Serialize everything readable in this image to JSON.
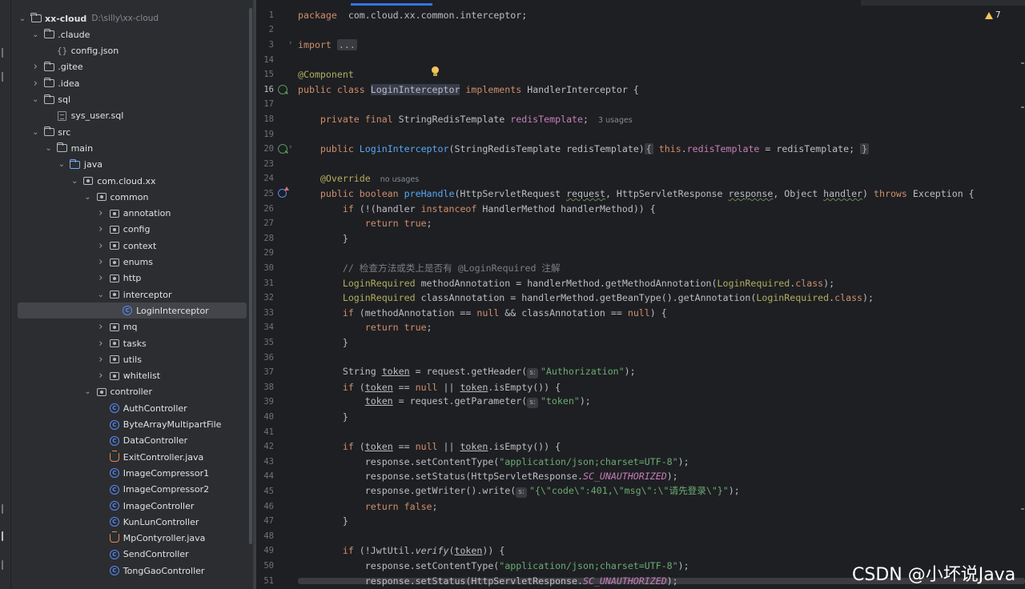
{
  "project": {
    "rows": [
      {
        "label": "xx-cloud",
        "path": "D:\\silly\\xx-cloud",
        "level": 0,
        "arrow": "down",
        "icon": "folder"
      },
      {
        "label": ".claude",
        "level": 1,
        "arrow": "down",
        "icon": "folder"
      },
      {
        "label": "config.json",
        "level": 2,
        "arrow": "",
        "icon": "json"
      },
      {
        "label": ".gitee",
        "level": 1,
        "arrow": "right",
        "icon": "folder"
      },
      {
        "label": ".idea",
        "level": 1,
        "arrow": "right",
        "icon": "folder"
      },
      {
        "label": "sql",
        "level": 1,
        "arrow": "down",
        "icon": "folder"
      },
      {
        "label": "sys_user.sql",
        "level": 2,
        "arrow": "",
        "icon": "sql"
      },
      {
        "label": "src",
        "level": 1,
        "arrow": "down",
        "icon": "folder"
      },
      {
        "label": "main",
        "level": 2,
        "arrow": "down",
        "icon": "folder"
      },
      {
        "label": "java",
        "level": 3,
        "arrow": "down",
        "icon": "folder-blue"
      },
      {
        "label": "com.cloud.xx",
        "level": 4,
        "arrow": "down",
        "icon": "package"
      },
      {
        "label": "common",
        "level": 5,
        "arrow": "down",
        "icon": "package"
      },
      {
        "label": "annotation",
        "level": 6,
        "arrow": "right",
        "icon": "package"
      },
      {
        "label": "config",
        "level": 6,
        "arrow": "right",
        "icon": "package"
      },
      {
        "label": "context",
        "level": 6,
        "arrow": "right",
        "icon": "package"
      },
      {
        "label": "enums",
        "level": 6,
        "arrow": "right",
        "icon": "package"
      },
      {
        "label": "http",
        "level": 6,
        "arrow": "right",
        "icon": "package"
      },
      {
        "label": "interceptor",
        "level": 6,
        "arrow": "down",
        "icon": "package"
      },
      {
        "label": "LoginInterceptor",
        "level": 7,
        "arrow": "",
        "icon": "class",
        "selected": true
      },
      {
        "label": "mq",
        "level": 6,
        "arrow": "right",
        "icon": "package"
      },
      {
        "label": "tasks",
        "level": 6,
        "arrow": "right",
        "icon": "package"
      },
      {
        "label": "utils",
        "level": 6,
        "arrow": "right",
        "icon": "package"
      },
      {
        "label": "whitelist",
        "level": 6,
        "arrow": "right",
        "icon": "package"
      },
      {
        "label": "controller",
        "level": 5,
        "arrow": "down",
        "icon": "package"
      },
      {
        "label": "AuthController",
        "level": 6,
        "arrow": "",
        "icon": "class"
      },
      {
        "label": "ByteArrayMultipartFile",
        "level": 6,
        "arrow": "",
        "icon": "class"
      },
      {
        "label": "DataController",
        "level": 6,
        "arrow": "",
        "icon": "class"
      },
      {
        "label": "ExitController.java",
        "level": 6,
        "arrow": "",
        "icon": "java"
      },
      {
        "label": "ImageCompressor1",
        "level": 6,
        "arrow": "",
        "icon": "class"
      },
      {
        "label": "ImageCompressor2",
        "level": 6,
        "arrow": "",
        "icon": "class"
      },
      {
        "label": "ImageController",
        "level": 6,
        "arrow": "",
        "icon": "class"
      },
      {
        "label": "KunLunController",
        "level": 6,
        "arrow": "",
        "icon": "class"
      },
      {
        "label": "MpContyroller.java",
        "level": 6,
        "arrow": "",
        "icon": "java"
      },
      {
        "label": "SendController",
        "level": 6,
        "arrow": "",
        "icon": "class"
      },
      {
        "label": "TongGaoController",
        "level": 6,
        "arrow": "",
        "icon": "class"
      }
    ]
  },
  "editor": {
    "warnings_count": "7",
    "current_line": "16",
    "lines": [
      {
        "n": "1",
        "segs": [
          [
            "kw",
            "package"
          ],
          [
            "",
            "  com.cloud.xx.common.interceptor;"
          ]
        ]
      },
      {
        "n": "2",
        "segs": []
      },
      {
        "n": "3",
        "gutter": "fold",
        "segs": [
          [
            "kw",
            "import"
          ],
          [
            "",
            " "
          ],
          [
            "fold",
            "..."
          ]
        ]
      },
      {
        "n": "14",
        "segs": []
      },
      {
        "n": "15",
        "segs": [
          [
            "ann",
            "@Component"
          ]
        ]
      },
      {
        "n": "16",
        "gutter": "bean",
        "segs": [
          [
            "kw",
            "public class "
          ],
          [
            "sel",
            "LoginInterceptor"
          ],
          [
            "",
            " "
          ],
          [
            "kw",
            "implements"
          ],
          [
            "",
            " HandlerInterceptor {"
          ]
        ]
      },
      {
        "n": "17",
        "segs": []
      },
      {
        "n": "18",
        "segs": [
          [
            "",
            "    "
          ],
          [
            "kw",
            "private final"
          ],
          [
            "",
            " StringRedisTemplate "
          ],
          [
            "fld",
            "redisTemplate"
          ],
          [
            "",
            ";"
          ],
          [
            "hint",
            "3 usages"
          ]
        ]
      },
      {
        "n": "19",
        "segs": []
      },
      {
        "n": "20",
        "gutter": "bean-fold",
        "segs": [
          [
            "",
            "    "
          ],
          [
            "kw",
            "public "
          ],
          [
            "fn",
            "LoginInterceptor"
          ],
          [
            "",
            "(StringRedisTemplate redisTemplate)"
          ],
          [
            "fold",
            "{"
          ],
          [
            "",
            " "
          ],
          [
            "kw",
            "this"
          ],
          [
            "",
            "."
          ],
          [
            "fld",
            "redisTemplate"
          ],
          [
            "",
            " = redisTemplate; "
          ],
          [
            "fold",
            "}"
          ]
        ]
      },
      {
        "n": "23",
        "segs": []
      },
      {
        "n": "24",
        "segs": [
          [
            "",
            "    "
          ],
          [
            "ann",
            "@Override"
          ],
          [
            "hint",
            "no usages"
          ]
        ]
      },
      {
        "n": "25",
        "gutter": "impl",
        "segs": [
          [
            "",
            "    "
          ],
          [
            "kw",
            "public boolean "
          ],
          [
            "fn",
            "preHandle"
          ],
          [
            "",
            "(HttpServletRequest "
          ],
          [
            "wavy",
            "request"
          ],
          [
            "",
            ", HttpServletResponse "
          ],
          [
            "wavy",
            "response"
          ],
          [
            "",
            ", Object "
          ],
          [
            "wavy",
            "handler"
          ],
          [
            "",
            ") "
          ],
          [
            "kw",
            "throws"
          ],
          [
            "",
            " Exception {"
          ]
        ]
      },
      {
        "n": "26",
        "segs": [
          [
            "",
            "        "
          ],
          [
            "kw",
            "if"
          ],
          [
            "",
            " (!(handler "
          ],
          [
            "kw",
            "instanceof"
          ],
          [
            "",
            " HandlerMethod handlerMethod)) {"
          ]
        ]
      },
      {
        "n": "27",
        "segs": [
          [
            "",
            "            "
          ],
          [
            "kw",
            "return true"
          ],
          [
            "",
            ";"
          ]
        ]
      },
      {
        "n": "28",
        "segs": [
          [
            "",
            "        }"
          ]
        ]
      },
      {
        "n": "29",
        "segs": []
      },
      {
        "n": "30",
        "segs": [
          [
            "",
            "        "
          ],
          [
            "cmt",
            "// 检查方法或类上是否有 @LoginRequired 注解"
          ]
        ]
      },
      {
        "n": "31",
        "segs": [
          [
            "",
            "        "
          ],
          [
            "ann",
            "LoginRequired"
          ],
          [
            "",
            " methodAnnotation = handlerMethod.getMethodAnnotation("
          ],
          [
            "ann",
            "LoginRequired"
          ],
          [
            "",
            "."
          ],
          [
            "kw",
            "class"
          ],
          [
            "",
            ");"
          ]
        ]
      },
      {
        "n": "32",
        "segs": [
          [
            "",
            "        "
          ],
          [
            "ann",
            "LoginRequired"
          ],
          [
            "",
            " classAnnotation = handlerMethod.getBeanType().getAnnotation("
          ],
          [
            "ann",
            "LoginRequired"
          ],
          [
            "",
            "."
          ],
          [
            "kw",
            "class"
          ],
          [
            "",
            ");"
          ]
        ]
      },
      {
        "n": "33",
        "segs": [
          [
            "",
            "        "
          ],
          [
            "kw",
            "if"
          ],
          [
            "",
            " (methodAnnotation == "
          ],
          [
            "kw",
            "null"
          ],
          [
            "",
            " && classAnnotation == "
          ],
          [
            "kw",
            "null"
          ],
          [
            "",
            ") {"
          ]
        ]
      },
      {
        "n": "34",
        "segs": [
          [
            "",
            "            "
          ],
          [
            "kw",
            "return true"
          ],
          [
            "",
            ";"
          ]
        ]
      },
      {
        "n": "35",
        "segs": [
          [
            "",
            "        }"
          ]
        ]
      },
      {
        "n": "36",
        "segs": []
      },
      {
        "n": "37",
        "segs": [
          [
            "",
            "        String "
          ],
          [
            "ul",
            "token"
          ],
          [
            "",
            " = request.getHeader("
          ],
          [
            "phint",
            "s:"
          ],
          [
            "str",
            "\"Authorization\""
          ],
          [
            "",
            ");"
          ]
        ]
      },
      {
        "n": "38",
        "segs": [
          [
            "",
            "        "
          ],
          [
            "kw",
            "if"
          ],
          [
            "",
            " ("
          ],
          [
            "ul",
            "token"
          ],
          [
            "",
            " == "
          ],
          [
            "kw",
            "null"
          ],
          [
            "",
            " || "
          ],
          [
            "ul",
            "token"
          ],
          [
            "",
            ".isEmpty()) {"
          ]
        ]
      },
      {
        "n": "39",
        "segs": [
          [
            "",
            "            "
          ],
          [
            "ul",
            "token"
          ],
          [
            "",
            " = request.getParameter("
          ],
          [
            "phint",
            "s:"
          ],
          [
            "str",
            "\"token\""
          ],
          [
            "",
            ");"
          ]
        ]
      },
      {
        "n": "40",
        "segs": [
          [
            "",
            "        }"
          ]
        ]
      },
      {
        "n": "41",
        "segs": []
      },
      {
        "n": "42",
        "segs": [
          [
            "",
            "        "
          ],
          [
            "kw",
            "if"
          ],
          [
            "",
            " ("
          ],
          [
            "ul",
            "token"
          ],
          [
            "",
            " == "
          ],
          [
            "kw",
            "null"
          ],
          [
            "",
            " || "
          ],
          [
            "ul",
            "token"
          ],
          [
            "",
            ".isEmpty()) {"
          ]
        ]
      },
      {
        "n": "43",
        "segs": [
          [
            "",
            "            response.setContentType("
          ],
          [
            "str",
            "\"application/json;charset=UTF-8\""
          ],
          [
            "",
            ");"
          ]
        ]
      },
      {
        "n": "44",
        "segs": [
          [
            "",
            "            response.setStatus(HttpServletResponse."
          ],
          [
            "const",
            "SC_UNAUTHORIZED"
          ],
          [
            "",
            ");"
          ]
        ]
      },
      {
        "n": "45",
        "segs": [
          [
            "",
            "            response.getWriter().write("
          ],
          [
            "phint",
            "s:"
          ],
          [
            "str",
            "\"{\\\"code\\\":401,\\\"msg\\\":\\\"请先登录\\\"}\""
          ],
          [
            "",
            ");"
          ]
        ]
      },
      {
        "n": "46",
        "segs": [
          [
            "",
            "            "
          ],
          [
            "kw",
            "return false"
          ],
          [
            "",
            ";"
          ]
        ]
      },
      {
        "n": "47",
        "segs": [
          [
            "",
            "        }"
          ]
        ]
      },
      {
        "n": "48",
        "segs": []
      },
      {
        "n": "49",
        "segs": [
          [
            "",
            "        "
          ],
          [
            "kw",
            "if"
          ],
          [
            "",
            " (!JwtUtil."
          ],
          [
            "ital",
            "verify"
          ],
          [
            "",
            "("
          ],
          [
            "ul",
            "token"
          ],
          [
            "",
            ")) {"
          ]
        ]
      },
      {
        "n": "50",
        "segs": [
          [
            "",
            "            response.setContentType("
          ],
          [
            "str",
            "\"application/json;charset=UTF-8\""
          ],
          [
            "",
            ");"
          ]
        ]
      },
      {
        "n": "51",
        "segs": [
          [
            "",
            "            response.setStatus(HttpServletResponse."
          ],
          [
            "const",
            "SC_UNAUTHORIZED"
          ],
          [
            "",
            ");"
          ]
        ]
      }
    ]
  },
  "watermark": "CSDN @小坏说Java"
}
